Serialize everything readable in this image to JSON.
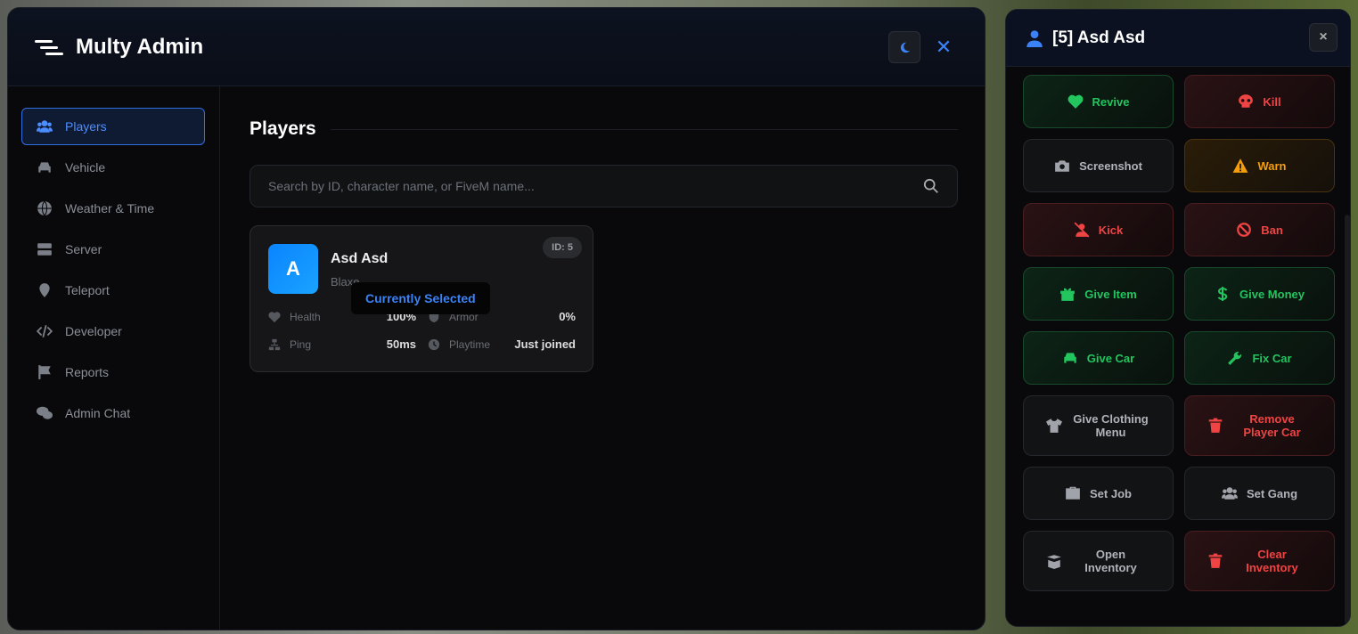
{
  "app": {
    "title": "Multy Admin"
  },
  "sidebar": {
    "items": [
      {
        "label": "Players",
        "icon": "users-icon",
        "active": true
      },
      {
        "label": "Vehicle",
        "icon": "car-icon"
      },
      {
        "label": "Weather & Time",
        "icon": "globe-icon"
      },
      {
        "label": "Server",
        "icon": "server-icon"
      },
      {
        "label": "Teleport",
        "icon": "map-pin-icon"
      },
      {
        "label": "Developer",
        "icon": "code-icon"
      },
      {
        "label": "Reports",
        "icon": "flag-icon"
      },
      {
        "label": "Admin Chat",
        "icon": "comments-icon"
      }
    ]
  },
  "main": {
    "title": "Players",
    "search_placeholder": "Search by ID, character name, or FiveM name...",
    "player": {
      "initial": "A",
      "name": "Asd Asd",
      "fivem": "Blaxe",
      "id": "ID: 5",
      "tooltip": "Currently Selected",
      "health_label": "Health",
      "health": "100%",
      "armor_label": "Armor",
      "armor": "0%",
      "ping_label": "Ping",
      "ping": "50ms",
      "playtime_label": "Playtime",
      "playtime": "Just joined"
    }
  },
  "panel": {
    "title": "[5] Asd Asd",
    "close": "×",
    "actions": [
      {
        "label": "Revive",
        "tone": "g",
        "icon": "heart-icon"
      },
      {
        "label": "Kill",
        "tone": "r",
        "icon": "skull-icon"
      },
      {
        "label": "Screenshot",
        "tone": "n",
        "icon": "camera-icon"
      },
      {
        "label": "Warn",
        "tone": "y",
        "icon": "warning-icon"
      },
      {
        "label": "Kick",
        "tone": "r",
        "icon": "user-slash-icon"
      },
      {
        "label": "Ban",
        "tone": "r",
        "icon": "ban-icon"
      },
      {
        "label": "Give Item",
        "tone": "g",
        "icon": "gift-icon"
      },
      {
        "label": "Give Money",
        "tone": "g",
        "icon": "dollar-icon"
      },
      {
        "label": "Give Car",
        "tone": "g",
        "icon": "car-icon"
      },
      {
        "label": "Fix Car",
        "tone": "g",
        "icon": "wrench-icon"
      },
      {
        "label": "Give Clothing Menu",
        "tone": "n",
        "icon": "shirt-icon"
      },
      {
        "label": "Remove Player Car",
        "tone": "r",
        "icon": "trash-icon"
      },
      {
        "label": "Set Job",
        "tone": "n",
        "icon": "briefcase-icon"
      },
      {
        "label": "Set Gang",
        "tone": "n",
        "icon": "users-icon"
      },
      {
        "label": "Open Inventory",
        "tone": "n",
        "icon": "box-open-icon"
      },
      {
        "label": "Clear Inventory",
        "tone": "r",
        "icon": "trash-icon"
      }
    ]
  }
}
